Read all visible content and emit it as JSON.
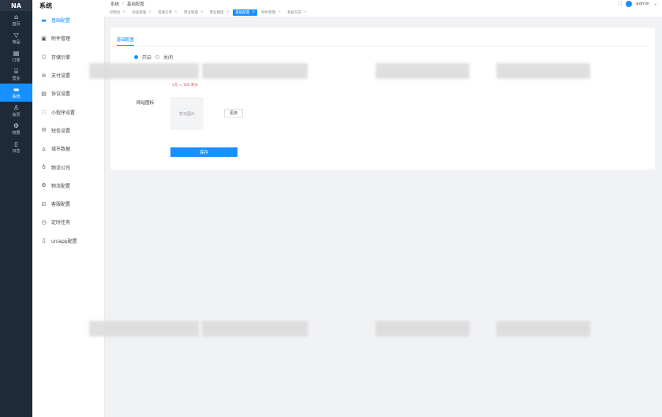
{
  "rail": {
    "logo": "NA",
    "items": [
      {
        "label": "首页",
        "icon": "home-icon"
      },
      {
        "label": "商品",
        "icon": "tag-icon"
      },
      {
        "label": "订单",
        "icon": "list-icon"
      },
      {
        "label": "营业",
        "icon": "shop-icon"
      },
      {
        "label": "系统",
        "icon": "monitor-icon"
      },
      {
        "label": "会员",
        "icon": "user-icon"
      },
      {
        "label": "权限",
        "icon": "gear-icon"
      },
      {
        "label": "日志",
        "icon": "doc-icon"
      }
    ]
  },
  "submenu": {
    "title": "系统",
    "items": [
      {
        "label": "基础配置",
        "icon": "doc-icon"
      },
      {
        "label": "附件管理",
        "icon": "folder-icon"
      },
      {
        "label": "存储引擎",
        "icon": "cloud-icon"
      },
      {
        "label": "支付设置",
        "icon": "wallet-icon"
      },
      {
        "label": "协议设置",
        "icon": "contract-icon"
      },
      {
        "label": "小程序设置",
        "icon": "chat-icon"
      },
      {
        "label": "短信设置",
        "icon": "mail-icon"
      },
      {
        "label": "城市数据",
        "icon": "map-icon"
      },
      {
        "label": "物流公司",
        "icon": "truck-icon"
      },
      {
        "label": "物流配置",
        "icon": "settings-icon"
      },
      {
        "label": "客服配置",
        "icon": "checkbox-icon"
      },
      {
        "label": "定时任务",
        "icon": "clock-icon"
      },
      {
        "label": "uniapp配置",
        "icon": "phone-icon"
      }
    ]
  },
  "topbar": {
    "breadcrumb": [
      "系统",
      "基础配置"
    ],
    "user": "admin"
  },
  "tabs": [
    {
      "label": "控制台",
      "active": false
    },
    {
      "label": "商品管理",
      "active": false
    },
    {
      "label": "普通订单",
      "active": false
    },
    {
      "label": "营业管理",
      "active": false
    },
    {
      "label": "营业额度",
      "active": false
    },
    {
      "label": "基础配置",
      "active": true
    },
    {
      "label": "附件管理",
      "active": false
    },
    {
      "label": "系统日志",
      "active": false
    }
  ],
  "form": {
    "tab_label": "基础配置",
    "radio_on_label": "开启",
    "radio_off_label": "关闭",
    "hint": "1元 = 100 积分",
    "image_label": "网站图标",
    "upload_placeholder": "暂无图片",
    "select_label": "更换",
    "save_label": "保存"
  }
}
